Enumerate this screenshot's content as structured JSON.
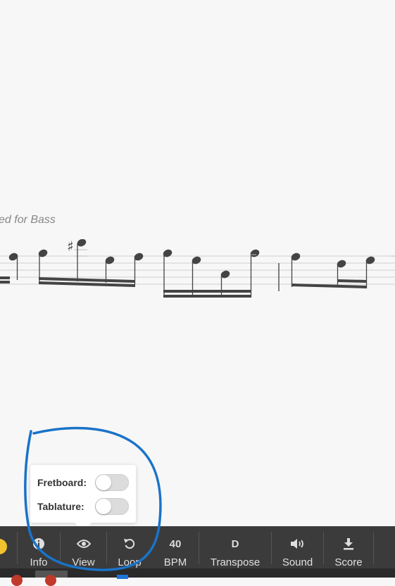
{
  "score": {
    "subtitle": "ed for Bass"
  },
  "view_popover": {
    "fretboard_label": "Fretboard:",
    "fretboard_on": false,
    "tablature_label": "Tablature:",
    "tablature_on": false
  },
  "toolbar": {
    "info": {
      "icon": "info-icon",
      "label": "Info"
    },
    "view": {
      "icon": "eye-icon",
      "label": "View"
    },
    "loop": {
      "icon": "loop-icon",
      "label": "Loop"
    },
    "bpm": {
      "value": "40",
      "label": "BPM"
    },
    "transpose": {
      "value": "D",
      "label": "Transpose"
    },
    "sound": {
      "icon": "speaker-icon",
      "label": "Sound"
    },
    "score": {
      "icon": "download-icon",
      "label": "Score"
    }
  },
  "colors": {
    "toolbar_bg": "#3b3b3b",
    "annotation": "#1a73c8",
    "accent_yellow": "#f2c12e"
  }
}
